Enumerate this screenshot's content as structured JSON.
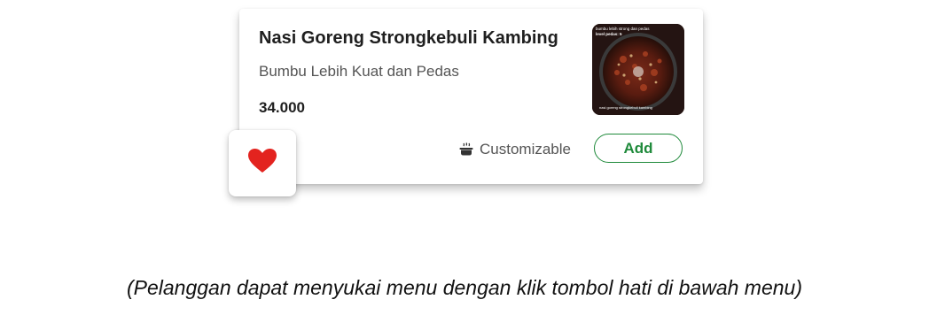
{
  "menu_item": {
    "name": "Nasi Goreng Strongkebuli Kambing",
    "description": "Bumbu Lebih Kuat dan Pedas",
    "price": "34.000",
    "image": {
      "overlay_top": "bumbu lebih strong dan pedas",
      "overlay_top_2": "level pedas: 5",
      "overlay_bottom": "nasi goreng strongkebuli kambing"
    },
    "customizable_label": "Customizable",
    "customizable_icon": "cooking-pot-icon",
    "add_label": "Add",
    "accent_color": "#1f8a3b"
  },
  "favorite": {
    "icon": "heart-icon",
    "color": "#e3231f"
  },
  "caption": "(Pelanggan dapat menyukai menu dengan klik tombol hati di bawah menu)"
}
